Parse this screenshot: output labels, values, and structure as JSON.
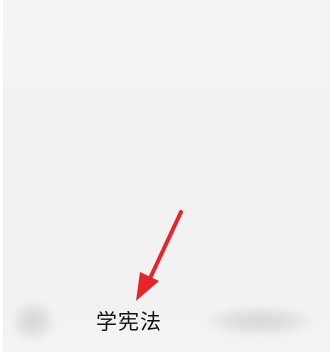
{
  "caption": {
    "label": "学宪法"
  },
  "annotation": {
    "arrow_color": "#e8232a",
    "icon": "arrow-pointer-icon"
  },
  "colors": {
    "panel_bg": "#f2f2f2",
    "text": "#111111"
  }
}
